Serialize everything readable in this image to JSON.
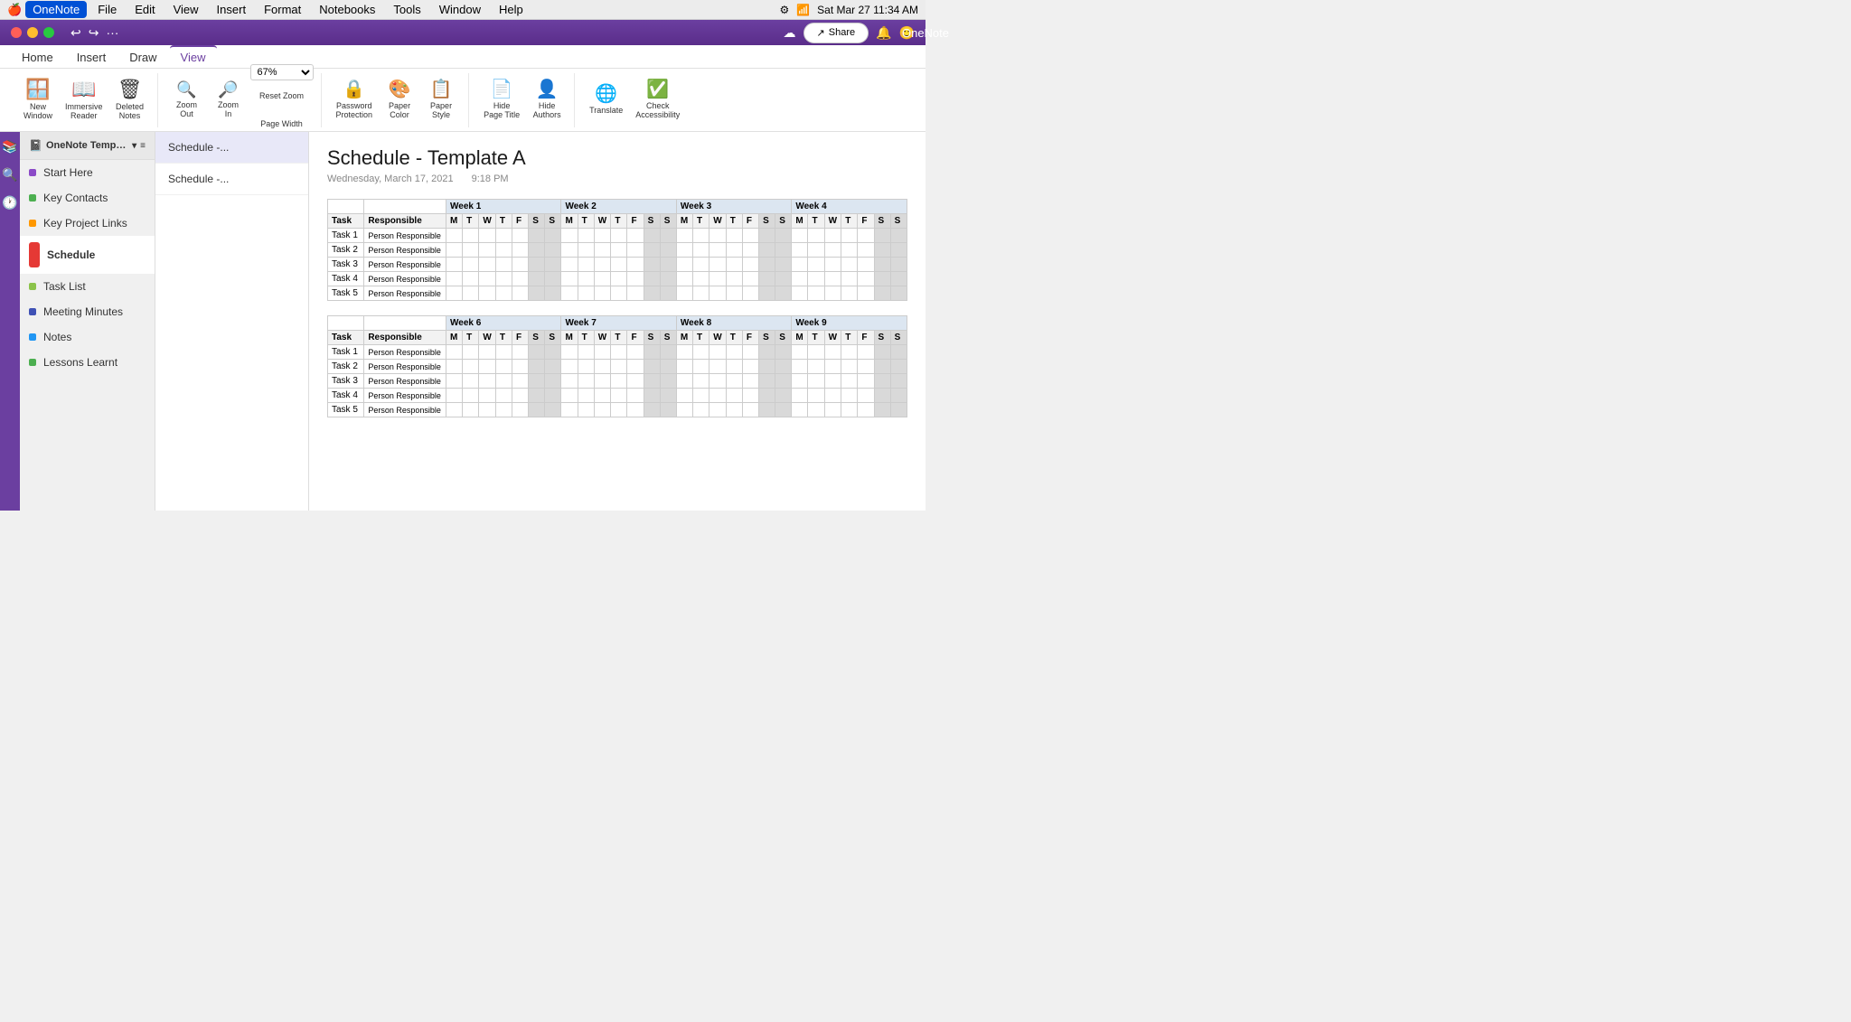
{
  "app": {
    "name": "OneNote",
    "title": "OneNote",
    "time": "Sat Mar 27  11:34 AM"
  },
  "menu_bar": {
    "apple": "🍎",
    "items": [
      "OneNote",
      "File",
      "Edit",
      "View",
      "Insert",
      "Format",
      "Notebooks",
      "Tools",
      "Window",
      "Help"
    ]
  },
  "ribbon_tabs": [
    "Home",
    "Insert",
    "Draw",
    "View"
  ],
  "active_tab": "View",
  "toolbar": {
    "new_window": "New\nWindow",
    "immersive_reader": "Immersive\nReader",
    "deleted_notes": "Deleted\nNotes",
    "zoom_out": "Zoom\nOut",
    "zoom_in": "Zoom\nIn",
    "zoom_value": "67%",
    "reset_zoom": "Reset Zoom",
    "page_width": "Page Width",
    "password_protection": "Password\nProtection",
    "paper_color": "Paper\nColor",
    "paper_style": "Paper\nStyle",
    "hide_page_title": "Hide\nPage Title",
    "hide_authors": "Hide\nAuthors",
    "translate": "Translate",
    "check_accessibility": "Check\nAccessibility"
  },
  "share_button": "Share",
  "notebook": {
    "name": "OneNote Template for Pr...",
    "icon": "📓"
  },
  "sections": [
    {
      "name": "Start Here",
      "color": "#8B4AC7",
      "active": false
    },
    {
      "name": "Key Contacts",
      "color": "#4CAF50",
      "active": false
    },
    {
      "name": "Key Project Links",
      "color": "#FF9800",
      "active": false
    },
    {
      "name": "Schedule",
      "color": "#E53935",
      "active": true
    },
    {
      "name": "Task List",
      "color": "#8BC34A",
      "active": false
    },
    {
      "name": "Meeting Minutes",
      "color": "#3F51B5",
      "active": false
    },
    {
      "name": "Notes",
      "color": "#2196F3",
      "active": false
    },
    {
      "name": "Lessons Learnt",
      "color": "#4CAF50",
      "active": false
    }
  ],
  "pages": [
    {
      "name": "Schedule -...",
      "active": true
    },
    {
      "name": "Schedule -...",
      "active": false
    }
  ],
  "page": {
    "title": "Schedule - Template A",
    "date": "Wednesday, March 17, 2021",
    "time": "9:18 PM"
  },
  "schedule": {
    "weeks_row1": [
      {
        "label": "Week 1",
        "span": 8
      },
      {
        "label": "",
        "span": 1
      },
      {
        "label": "Week 2",
        "span": 8
      },
      {
        "label": "",
        "span": 1
      },
      {
        "label": "Week 3",
        "span": 8
      },
      {
        "label": "",
        "span": 1
      },
      {
        "label": "Week 4",
        "span": 8
      }
    ],
    "weeks_row2": [
      {
        "label": "Week 6",
        "span": 8
      },
      {
        "label": "",
        "span": 1
      },
      {
        "label": "Week 7",
        "span": 8
      },
      {
        "label": "",
        "span": 1
      },
      {
        "label": "Week 8",
        "span": 8
      },
      {
        "label": "",
        "span": 1
      },
      {
        "label": "Week 9",
        "span": 8
      }
    ],
    "days": [
      "M",
      "T",
      "W",
      "T",
      "F",
      "S",
      "S"
    ],
    "tasks": [
      "Task 1",
      "Task 2",
      "Task 3",
      "Task 4",
      "Task 5"
    ],
    "responsible": "Person Responsible"
  }
}
